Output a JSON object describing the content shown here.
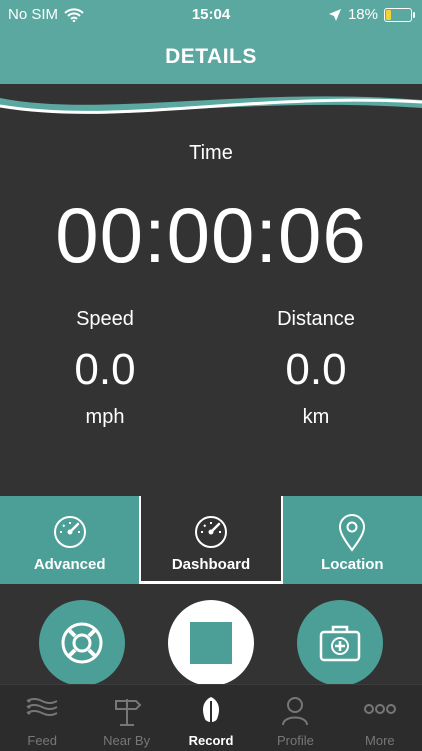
{
  "status": {
    "carrier": "No SIM",
    "time": "15:04",
    "battery": "18%",
    "battery_level": 0.18
  },
  "header": {
    "title": "DETAILS"
  },
  "main": {
    "time_label": "Time",
    "timer": "00:00:06",
    "speed": {
      "title": "Speed",
      "value": "0.0",
      "unit": "mph"
    },
    "distance": {
      "title": "Distance",
      "value": "0.0",
      "unit": "km"
    }
  },
  "tabs": [
    {
      "label": "Advanced",
      "icon": "speedometer-icon"
    },
    {
      "label": "Dashboard",
      "icon": "speedometer-icon",
      "active": true
    },
    {
      "label": "Location",
      "icon": "location-pin-icon"
    }
  ],
  "actions": {
    "left_icon": "lifebuoy-icon",
    "center_icon": "stop-icon",
    "right_icon": "first-aid-kit-icon"
  },
  "nav": [
    {
      "label": "Feed",
      "icon": "feed-icon"
    },
    {
      "label": "Near By",
      "icon": "signpost-icon"
    },
    {
      "label": "Record",
      "icon": "paddle-icon",
      "active": true
    },
    {
      "label": "Profile",
      "icon": "profile-icon"
    },
    {
      "label": "More",
      "icon": "more-icon"
    }
  ],
  "colors": {
    "teal": "#5aa8a0",
    "teal_dark": "#4c9f97",
    "background": "#333333"
  }
}
